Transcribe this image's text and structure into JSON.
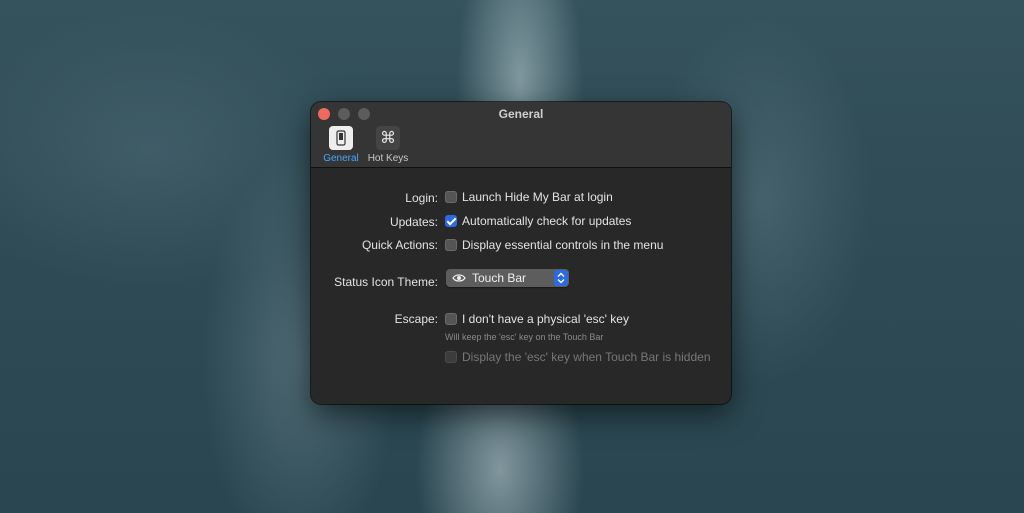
{
  "window": {
    "title": "General"
  },
  "tabs": [
    {
      "label": "General",
      "icon": "phone-icon",
      "selected": true
    },
    {
      "label": "Hot Keys",
      "icon": "command-key-icon",
      "selected": false,
      "glyph": "⌘"
    }
  ],
  "settings": {
    "login": {
      "label": "Login:",
      "option": "Launch Hide My Bar at login",
      "checked": false
    },
    "updates": {
      "label": "Updates:",
      "option": "Automatically check for updates",
      "checked": true
    },
    "quick_actions": {
      "label": "Quick Actions:",
      "option": "Display essential controls in the menu",
      "checked": false
    },
    "theme": {
      "label": "Status Icon Theme:",
      "value": "Touch Bar"
    },
    "escape": {
      "label": "Escape:",
      "option": "I don't have a physical 'esc' key",
      "checked": false,
      "hint": "Will keep the 'esc' key on the Touch Bar",
      "sub_option": "Display the 'esc' key when Touch Bar is hidden",
      "sub_enabled": false
    }
  },
  "colors": {
    "accent": "#2d6ae0",
    "tab_selected_text": "#43a6ff",
    "close": "#ed6a5e"
  }
}
